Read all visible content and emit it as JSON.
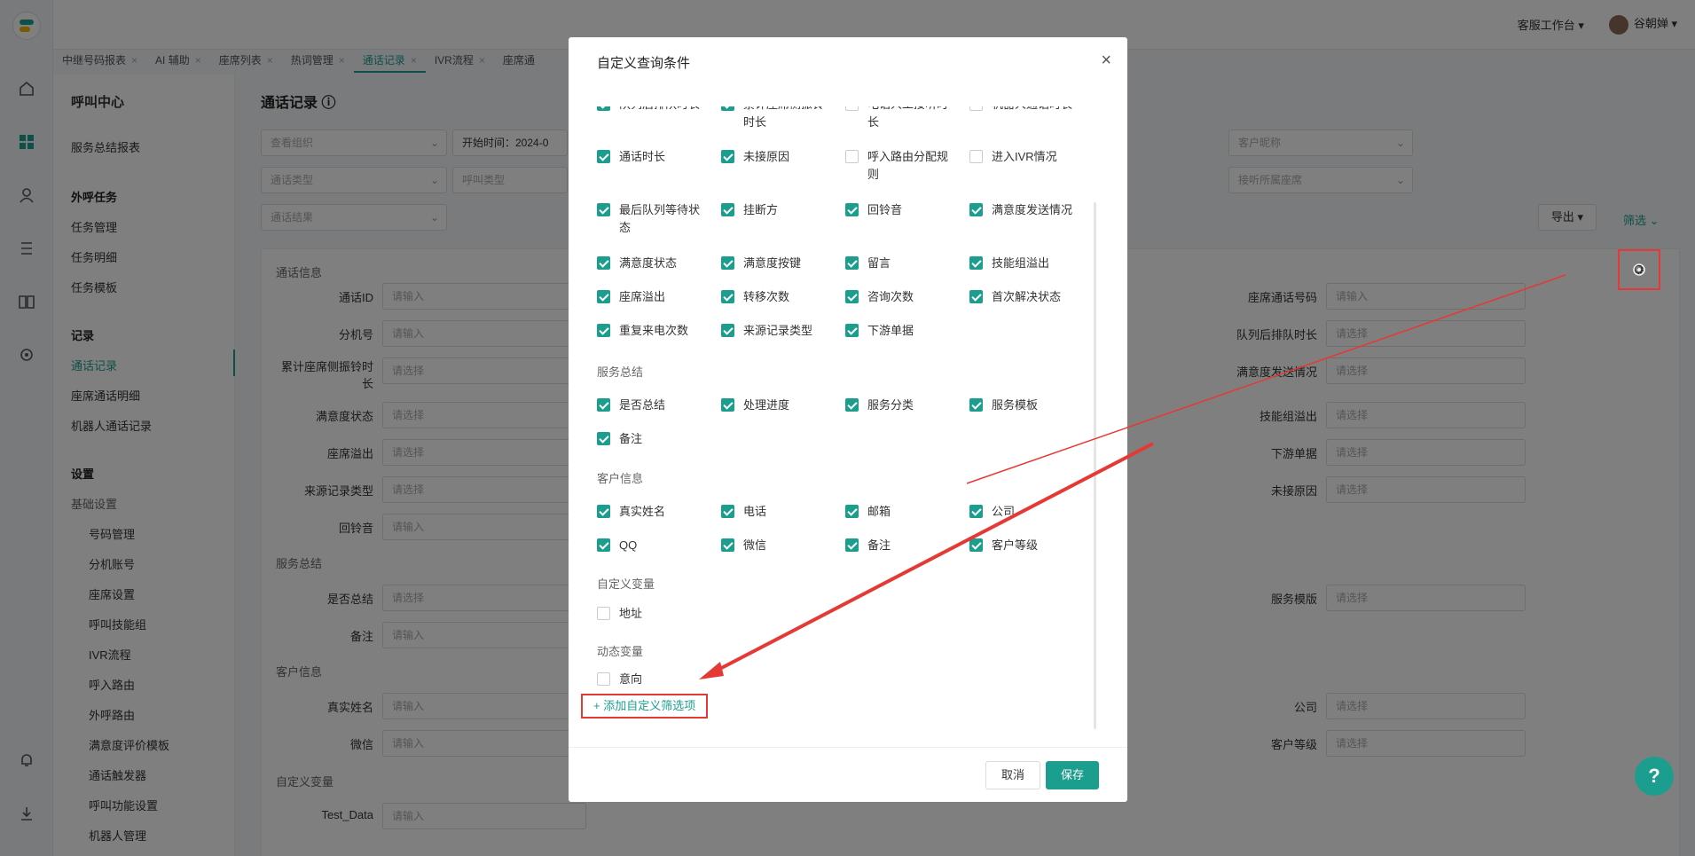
{
  "topbar": {
    "workspace": "客服工作台",
    "user": "谷朝婵"
  },
  "tabs": [
    {
      "label": "中继号码报表"
    },
    {
      "label": "AI 辅助"
    },
    {
      "label": "座席列表"
    },
    {
      "label": "热词管理"
    },
    {
      "label": "通话记录"
    },
    {
      "label": "IVR流程"
    },
    {
      "label": "座席通"
    }
  ],
  "sidenav": {
    "title": "呼叫中心",
    "service_report": "服务总结报表",
    "outbound": "外呼任务",
    "task_manage": "任务管理",
    "task_detail": "任务明细",
    "task_template": "任务模板",
    "record": "记录",
    "call_record": "通话记录",
    "seat_detail": "座席通话明细",
    "robot_record": "机器人通话记录",
    "settings": "设置",
    "basic": "基础设置",
    "items": [
      "号码管理",
      "分机账号",
      "座席设置",
      "呼叫技能组",
      "IVR流程",
      "呼入路由",
      "外呼路由",
      "满意度评价模板",
      "通话触发器",
      "呼叫功能设置",
      "机器人管理"
    ]
  },
  "main": {
    "title": "通话记录",
    "filters": {
      "org": "查看组织",
      "start": "开始时间：2024-0",
      "call_type": "通话类型",
      "in_type": "呼叫类型",
      "result": "通话结果",
      "nickname": "客户昵称",
      "listen_seat": "接听所属座席"
    },
    "export": "导出",
    "filter": "筛选",
    "sections": {
      "call_info": "通话信息",
      "service": "服务总结",
      "customer": "客户信息",
      "custom": "自定义变量"
    },
    "labels": {
      "call_id": "通话ID",
      "ext": "分机号",
      "ring": "累计座席侧振铃时长",
      "sat": "满意度状态",
      "overflow": "座席溢出",
      "src_type": "来源记录类型",
      "ringback": "回铃音",
      "summary": "是否总结",
      "remark": "备注",
      "real_name": "真实姓名",
      "wechat": "微信",
      "test": "Test_Data",
      "seat_phone": "座席通话号码",
      "queue_after": "队列后排队时长",
      "sat_send": "满意度发送情况",
      "skill_overflow": "技能组溢出",
      "downstream": "下游单据",
      "no_answer": "未接原因",
      "svc_tpl": "服务模版",
      "company": "公司",
      "level": "客户等级"
    },
    "ph": {
      "input": "请输入",
      "select": "请选择"
    }
  },
  "dialog": {
    "title": "自定义查询条件",
    "sections": {
      "service": "服务总结",
      "customer": "客户信息",
      "custom": "自定义变量",
      "dynamic": "动态变量"
    },
    "row0": [
      "队列后排队时长",
      "累计座席侧振铃时长",
      "电话人工接听时长",
      "机器人通话时长"
    ],
    "call_items": [
      {
        "label": "通话时长",
        "on": true
      },
      {
        "label": "未接原因",
        "on": true
      },
      {
        "label": "呼入路由分配规则",
        "on": false
      },
      {
        "label": "进入IVR情况",
        "on": false
      },
      {
        "label": "最后队列等待状态",
        "on": true
      },
      {
        "label": "挂断方",
        "on": true
      },
      {
        "label": "回铃音",
        "on": true
      },
      {
        "label": "满意度发送情况",
        "on": true
      },
      {
        "label": "满意度状态",
        "on": true
      },
      {
        "label": "满意度按键",
        "on": true
      },
      {
        "label": "留言",
        "on": true
      },
      {
        "label": "技能组溢出",
        "on": true
      },
      {
        "label": "座席溢出",
        "on": true
      },
      {
        "label": "转移次数",
        "on": true
      },
      {
        "label": "咨询次数",
        "on": true
      },
      {
        "label": "首次解决状态",
        "on": true
      },
      {
        "label": "重复来电次数",
        "on": true
      },
      {
        "label": "来源记录类型",
        "on": true
      },
      {
        "label": "下游单据",
        "on": true
      }
    ],
    "service_items": [
      {
        "label": "是否总结",
        "on": true
      },
      {
        "label": "处理进度",
        "on": true
      },
      {
        "label": "服务分类",
        "on": true
      },
      {
        "label": "服务模板",
        "on": true
      },
      {
        "label": "备注",
        "on": true
      }
    ],
    "customer_items": [
      {
        "label": "真实姓名",
        "on": true
      },
      {
        "label": "电话",
        "on": true
      },
      {
        "label": "邮箱",
        "on": true
      },
      {
        "label": "公司",
        "on": true
      },
      {
        "label": "QQ",
        "on": true
      },
      {
        "label": "微信",
        "on": true
      },
      {
        "label": "备注",
        "on": true
      },
      {
        "label": "客户等级",
        "on": true
      }
    ],
    "custom_items": [
      {
        "label": "地址",
        "on": false
      }
    ],
    "dynamic_items": [
      {
        "label": "意向",
        "on": false
      }
    ],
    "add_link": "+ 添加自定义筛选项",
    "cancel": "取消",
    "save": "保存"
  },
  "colors": {
    "accent": "#1c9e8f",
    "highlight": "#e53935"
  }
}
